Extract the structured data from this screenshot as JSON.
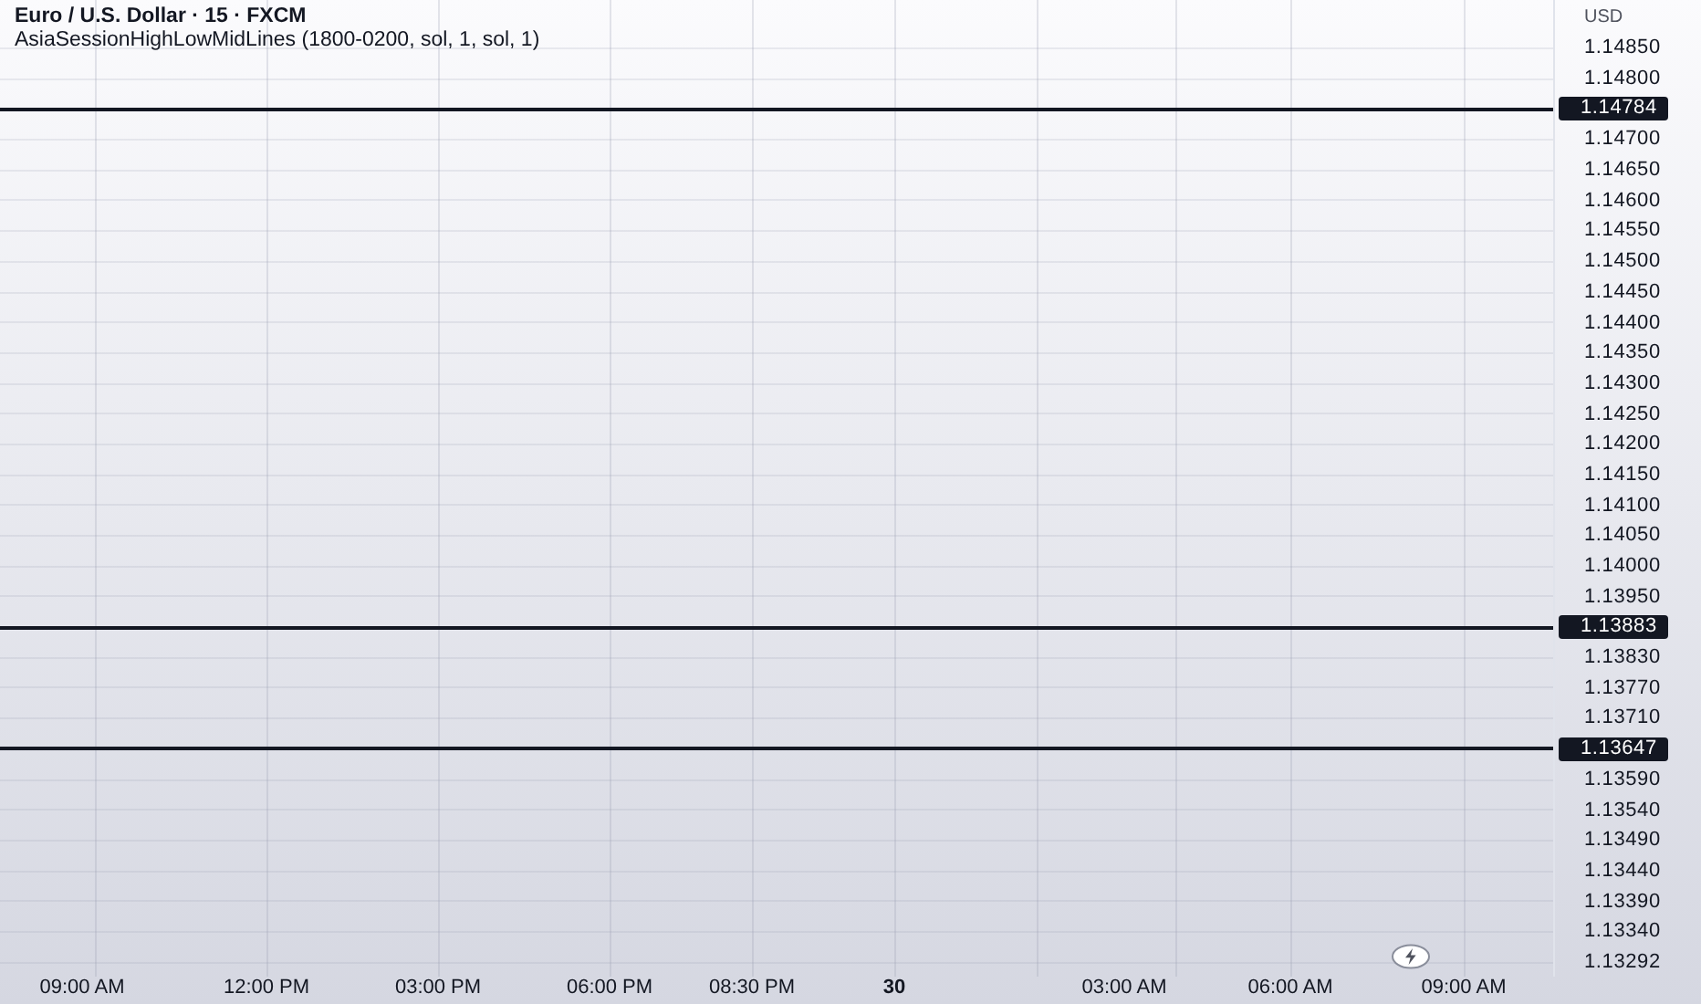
{
  "legend": {
    "symbol": "Euro / U.S. Dollar · 15 · FXCM",
    "indicator": "AsiaSessionHighLowMidLines (1800-0200, sol, 1, sol, 1)"
  },
  "price_axis": {
    "currency": "USD",
    "labels": [
      {
        "kind": "tick",
        "text": "1.14850"
      },
      {
        "kind": "tick",
        "text": "1.14800"
      },
      {
        "kind": "marker",
        "text": "1.14784"
      },
      {
        "kind": "tick",
        "text": "1.14700"
      },
      {
        "kind": "tick",
        "text": "1.14650"
      },
      {
        "kind": "tick",
        "text": "1.14600"
      },
      {
        "kind": "tick",
        "text": "1.14550"
      },
      {
        "kind": "tick",
        "text": "1.14500"
      },
      {
        "kind": "tick",
        "text": "1.14450"
      },
      {
        "kind": "tick",
        "text": "1.14400"
      },
      {
        "kind": "tick",
        "text": "1.14350"
      },
      {
        "kind": "tick",
        "text": "1.14300"
      },
      {
        "kind": "tick",
        "text": "1.14250"
      },
      {
        "kind": "tick",
        "text": "1.14200"
      },
      {
        "kind": "tick",
        "text": "1.14150"
      },
      {
        "kind": "tick",
        "text": "1.14100"
      },
      {
        "kind": "tick",
        "text": "1.14050"
      },
      {
        "kind": "tick",
        "text": "1.14000"
      },
      {
        "kind": "tick",
        "text": "1.13950"
      },
      {
        "kind": "marker",
        "text": "1.13883"
      },
      {
        "kind": "tick",
        "text": "1.13830"
      },
      {
        "kind": "tick",
        "text": "1.13770"
      },
      {
        "kind": "tick",
        "text": "1.13710"
      },
      {
        "kind": "marker",
        "text": "1.13647"
      },
      {
        "kind": "tick",
        "text": "1.13590"
      },
      {
        "kind": "tick",
        "text": "1.13540"
      },
      {
        "kind": "tick",
        "text": "1.13490"
      },
      {
        "kind": "tick",
        "text": "1.13440"
      },
      {
        "kind": "tick",
        "text": "1.13390"
      },
      {
        "kind": "tick",
        "text": "1.13340"
      },
      {
        "kind": "tick",
        "text": "1.13292"
      }
    ]
  },
  "time_axis": [
    {
      "kind": "time",
      "text": "09:00 AM"
    },
    {
      "kind": "time",
      "text": "12:00 PM"
    },
    {
      "kind": "time",
      "text": "03:00 PM"
    },
    {
      "kind": "time",
      "text": "06:00 PM"
    },
    {
      "kind": "time",
      "text": "08:30 PM"
    },
    {
      "kind": "day",
      "text": "30"
    },
    {
      "kind": "time",
      "text": "03:00 AM"
    },
    {
      "kind": "time",
      "text": "06:00 AM"
    },
    {
      "kind": "time",
      "text": "09:00 AM"
    }
  ]
}
